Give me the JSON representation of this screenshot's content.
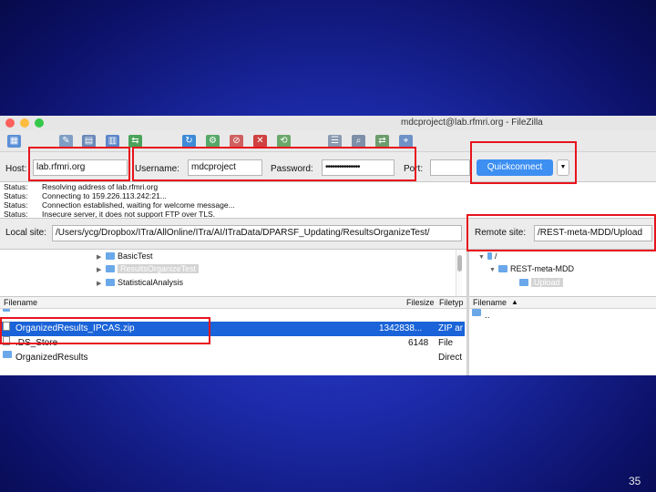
{
  "window": {
    "title": "mdcproject@lab.rfmri.org - FileZilla"
  },
  "quickconnect": {
    "host_label": "Host:",
    "host_value": "lab.rfmri.org",
    "username_label": "Username:",
    "username_value": "mdcproject",
    "password_label": "Password:",
    "password_value": "•••••••••••••••",
    "port_label": "Port:",
    "port_value": "",
    "button_label": "Quickconnect",
    "dropdown": "▼"
  },
  "log": [
    {
      "status": "Status:",
      "message": "Resolving address of lab.rfmri.org"
    },
    {
      "status": "Status:",
      "message": "Connecting to 159.226.113.242:21..."
    },
    {
      "status": "Status:",
      "message": "Connection established, waiting for welcome message..."
    },
    {
      "status": "Status:",
      "message": "Insecure server, it does not support FTP over TLS."
    }
  ],
  "local": {
    "site_label": "Local site:",
    "site_path": "/Users/ycg/Dropbox/ITra/AllOnline/ITra/AI/ITraData/DPARSF_Updating/ResultsOrganizeTest/",
    "tree": [
      "BasicTest",
      "ResultsOrganizeTest",
      "StatisticalAnalysis"
    ],
    "headers": {
      "name": "Filename",
      "size": "Filesize",
      "type": "Filetyp"
    },
    "files": [
      {
        "name": "..",
        "size": "",
        "type": ""
      },
      {
        "name": "OrganizedResults_IPCAS.zip",
        "size": "1342838...",
        "type": "ZIP ar"
      },
      {
        "name": ".DS_Store",
        "size": "6148",
        "type": "File"
      },
      {
        "name": "OrganizedResults",
        "size": "",
        "type": "Direct"
      }
    ]
  },
  "remote": {
    "site_label": "Remote site:",
    "site_path": "/REST-meta-MDD/Upload",
    "tree": [
      "/",
      "REST-meta-MDD",
      "Upload"
    ],
    "headers": {
      "name": "Filename"
    },
    "files": [
      {
        "name": ".."
      }
    ]
  },
  "slide": {
    "page_number": "35"
  }
}
